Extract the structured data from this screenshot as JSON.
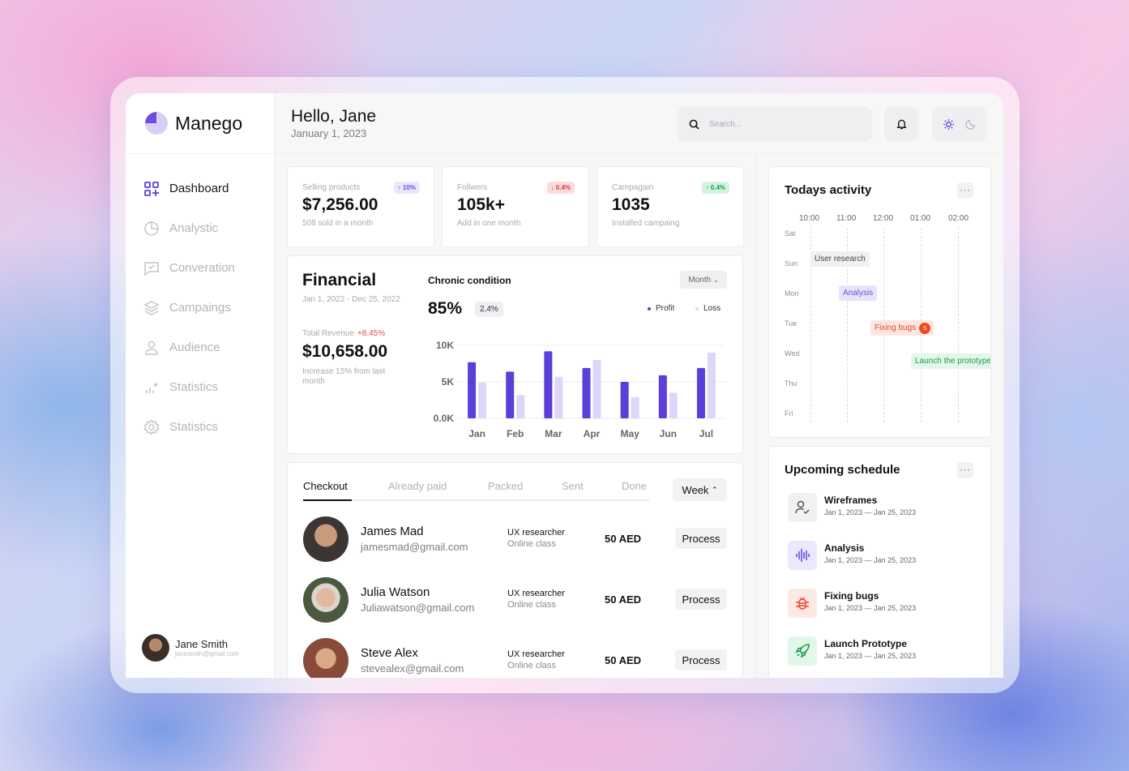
{
  "brand": {
    "name": "Manego"
  },
  "nav": [
    {
      "label": "Dashboard",
      "icon": "dashboard-icon",
      "active": true
    },
    {
      "label": "Analystic",
      "icon": "pie-chart-icon"
    },
    {
      "label": "Converation",
      "icon": "chat-icon"
    },
    {
      "label": "Campaings",
      "icon": "layers-icon"
    },
    {
      "label": "Audience",
      "icon": "user-icon"
    },
    {
      "label": "Statistics",
      "icon": "stats-icon"
    },
    {
      "label": "Statistics",
      "icon": "gear-icon"
    }
  ],
  "user": {
    "name": "Jane Smith",
    "email": "janesmith@gmail.com"
  },
  "header": {
    "greeting": "Hello, Jane",
    "date": "January 1, 2023",
    "search_placeholder": "Search..."
  },
  "stats": [
    {
      "label": "Selling products",
      "value": "$7,256.00",
      "sub": "508 sold in a month",
      "badge": "10%",
      "badge_dir": "up",
      "badge_color": "#6b4fe0",
      "badge_bg": "#ebe7fb"
    },
    {
      "label": "Follwers",
      "value": "105k+",
      "sub": "Add in one month",
      "badge": "0.4%",
      "badge_dir": "down",
      "badge_color": "#d9363e",
      "badge_bg": "#fbdcdc"
    },
    {
      "label": "Campagain",
      "value": "1035",
      "sub": "Installed campaing",
      "badge": "0.4%",
      "badge_dir": "up",
      "badge_color": "#1a9a4b",
      "badge_bg": "#d6f3e0"
    }
  ],
  "financial": {
    "title": "Financial",
    "range": "Jan 1, 2022 - Dec 25, 2022",
    "revenue_label": "Total Revenue",
    "revenue_change": "+8.45%",
    "revenue": "$10,658.00",
    "note": "Increase 15% from last month"
  },
  "chart_data": {
    "type": "bar",
    "title": "Chronic condition",
    "headline": "85%",
    "headline_badge": "2,4%",
    "filter": "Month",
    "categories": [
      "Jan",
      "Feb",
      "Mar",
      "Apr",
      "May",
      "Jun",
      "Jul"
    ],
    "series": [
      {
        "name": "Profit",
        "color": "#5b3fd8",
        "values": [
          7.7,
          6.4,
          9.2,
          6.9,
          5.0,
          5.9,
          6.9
        ]
      },
      {
        "name": "Loss",
        "color": "#ddd6fa",
        "values": [
          4.9,
          3.2,
          5.7,
          8.0,
          2.9,
          3.5,
          9.0
        ]
      }
    ],
    "y_ticks": [
      "0.0K",
      "5K",
      "10K"
    ],
    "ylim": [
      0,
      10
    ],
    "ylabel": "",
    "xlabel": "",
    "legend": "top-right",
    "grid": true
  },
  "orders": {
    "tabs": [
      "Checkout",
      "Already paid",
      "Packed",
      "Sent",
      "Done"
    ],
    "filter": "Week",
    "rows": [
      {
        "name": "James Mad",
        "email": "jamesmad@gmail.com",
        "role": "UX researcher",
        "type": "Online class",
        "amount": "50 AED",
        "action": "Process"
      },
      {
        "name": "Julia Watson",
        "email": "Juliawatson@gmail.com",
        "role": "UX researcher",
        "type": "Online class",
        "amount": "50 AED",
        "action": "Process"
      },
      {
        "name": "Steve Alex",
        "email": "stevealex@gmail.com",
        "role": "UX researcher",
        "type": "Online class",
        "amount": "50 AED",
        "action": "Process"
      }
    ]
  },
  "activity": {
    "title": "Todays activity",
    "more": "···",
    "times": [
      "10:00",
      "11:00",
      "12:00",
      "01:00",
      "02:00"
    ],
    "days": [
      "Sat",
      "Sun",
      "Mon",
      "Tue",
      "Wed",
      "Thu",
      "Fri"
    ],
    "events": [
      {
        "label": "User research",
        "color": "#444",
        "bg": "#f0f0f2"
      },
      {
        "label": "Analysis",
        "color": "#6b4fe0",
        "bg": "#e8e3fb"
      },
      {
        "label": "Fixing bugs",
        "color": "#e8462b",
        "bg": "#fde6e1",
        "count": "5"
      },
      {
        "label": "Launch the prototype",
        "color": "#1a9a4b",
        "bg": "#e3f6ea"
      }
    ]
  },
  "schedule": {
    "title": "Upcoming schedule",
    "more": "···",
    "items": [
      {
        "name": "Wireframes",
        "date": "Jan 1, 2023 — Jan 25, 2023",
        "icon": "user-check-icon",
        "color": "#555",
        "bg": "#f1f1f3"
      },
      {
        "name": "Analysis",
        "date": "Jan 1, 2023 — Jan 25, 2023",
        "icon": "waveform-icon",
        "color": "#6b4fe0",
        "bg": "#ece8fb"
      },
      {
        "name": "Fixing bugs",
        "date": "Jan 1, 2023 — Jan 25, 2023",
        "icon": "bug-icon",
        "color": "#e8462b",
        "bg": "#fde9e4"
      },
      {
        "name": "Launch Prototype",
        "date": "Jan 1, 2023 — Jan 25, 2023",
        "icon": "rocket-icon",
        "color": "#1a9a4b",
        "bg": "#e3f6ea"
      }
    ]
  }
}
